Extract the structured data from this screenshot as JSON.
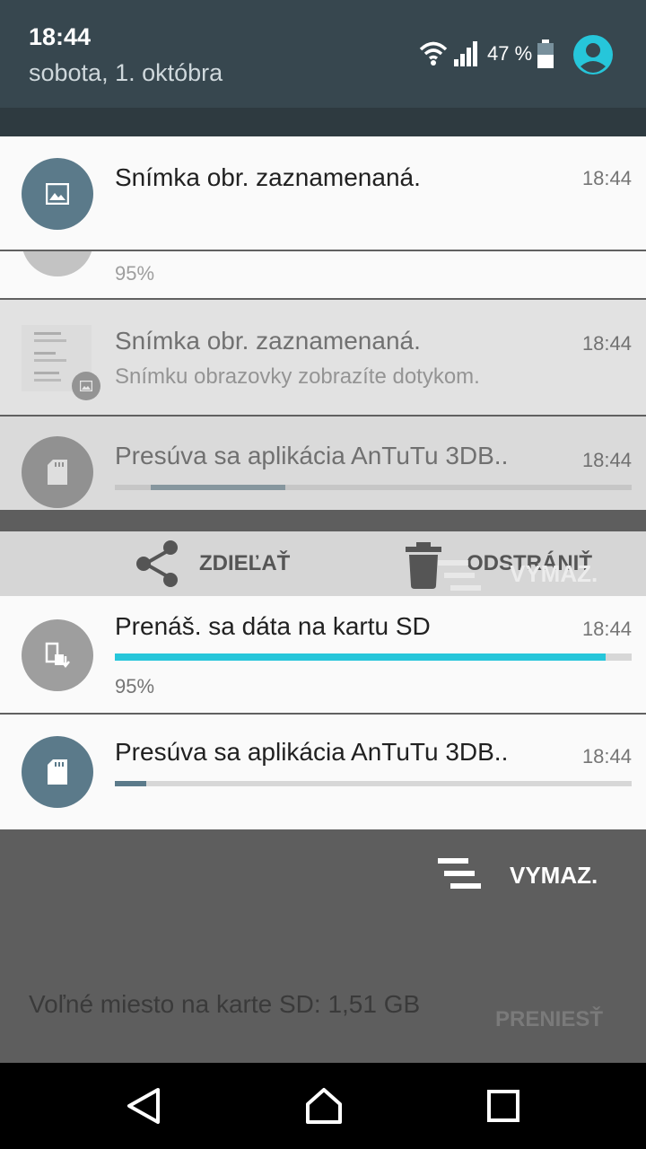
{
  "status_bar": {
    "time": "18:44",
    "date": "sobota, 1. októbra",
    "battery_percent": "47 %",
    "icons": [
      "wifi-icon",
      "signal-icon",
      "battery-icon",
      "user-avatar-icon"
    ]
  },
  "notifications": [
    {
      "title": "Snímka obr. zaznamenaná.",
      "time": "18:44",
      "icon": "image-icon"
    },
    {
      "subtitle": "95%",
      "icon": "partial-card-icon"
    },
    {
      "title": "Snímka obr. zaznamenaná.",
      "subtitle": "Snímku obrazovky zobrazíte dotykom.",
      "time": "18:44",
      "icon": "screenshot-thumbnail"
    },
    {
      "title": "Presúva sa aplikácia AnTuTu 3DB..",
      "time": "18:44",
      "icon": "sd-card-icon",
      "progress": 0.33
    },
    {
      "title": "Prenáš. sa dáta na kartu SD",
      "subtitle": "95%",
      "time": "18:44",
      "icon": "phone-to-sd-icon",
      "progress": 0.95
    },
    {
      "title": "Presúva sa aplikácia AnTuTu 3DB..",
      "time": "18:44",
      "icon": "sd-card-icon",
      "progress": 0.06
    }
  ],
  "actions": {
    "share": "ZDIEĽAŤ",
    "delete": "ODSTRÁNIŤ",
    "ghost_clear": "VYMAZ."
  },
  "clear_all": "VYMAZ.",
  "sd_info": {
    "text": "Voľné miesto na karte SD: 1,51 GB",
    "button": "PRENIESŤ"
  },
  "colors": {
    "accent": "#26c6da",
    "status_bar": "#37474f",
    "icon_blue": "#5b7a8a"
  }
}
